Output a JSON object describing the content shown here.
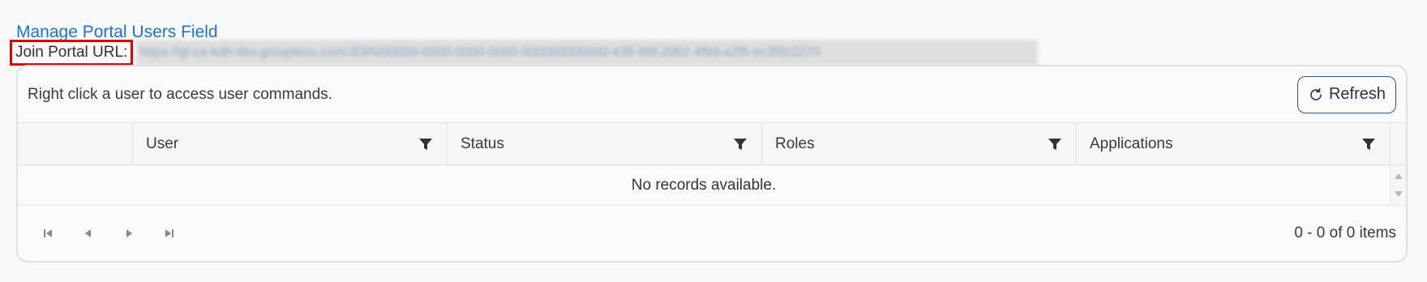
{
  "page": {
    "title_link": "Manage Portal Users Field",
    "join_label": "Join Portal URL:",
    "join_url": "https://gl-ca-kdh-dev.grouplesu.com/JOIN/00000-0000-0000-0000-000000000000-436-86f-2062-4f9d-a2f5-ec3f0c2270"
  },
  "grid": {
    "toolbar_message": "Right click a user to access user commands.",
    "refresh_label": "Refresh",
    "refresh_icon": "refresh-icon",
    "columns": [
      {
        "label": "User",
        "icon": "filter-icon"
      },
      {
        "label": "Status",
        "icon": "filter-icon"
      },
      {
        "label": "Roles",
        "icon": "filter-icon"
      },
      {
        "label": "Applications",
        "icon": "filter-icon"
      }
    ],
    "empty_message": "No records available.",
    "pager": {
      "info": "0 - 0 of 0 items",
      "buttons": [
        "first-page-icon",
        "previous-page-icon",
        "next-page-icon",
        "last-page-icon"
      ]
    }
  },
  "colors": {
    "link": "#1a73d9",
    "highlight_border": "#e00000",
    "button_border": "#1f5a92"
  }
}
